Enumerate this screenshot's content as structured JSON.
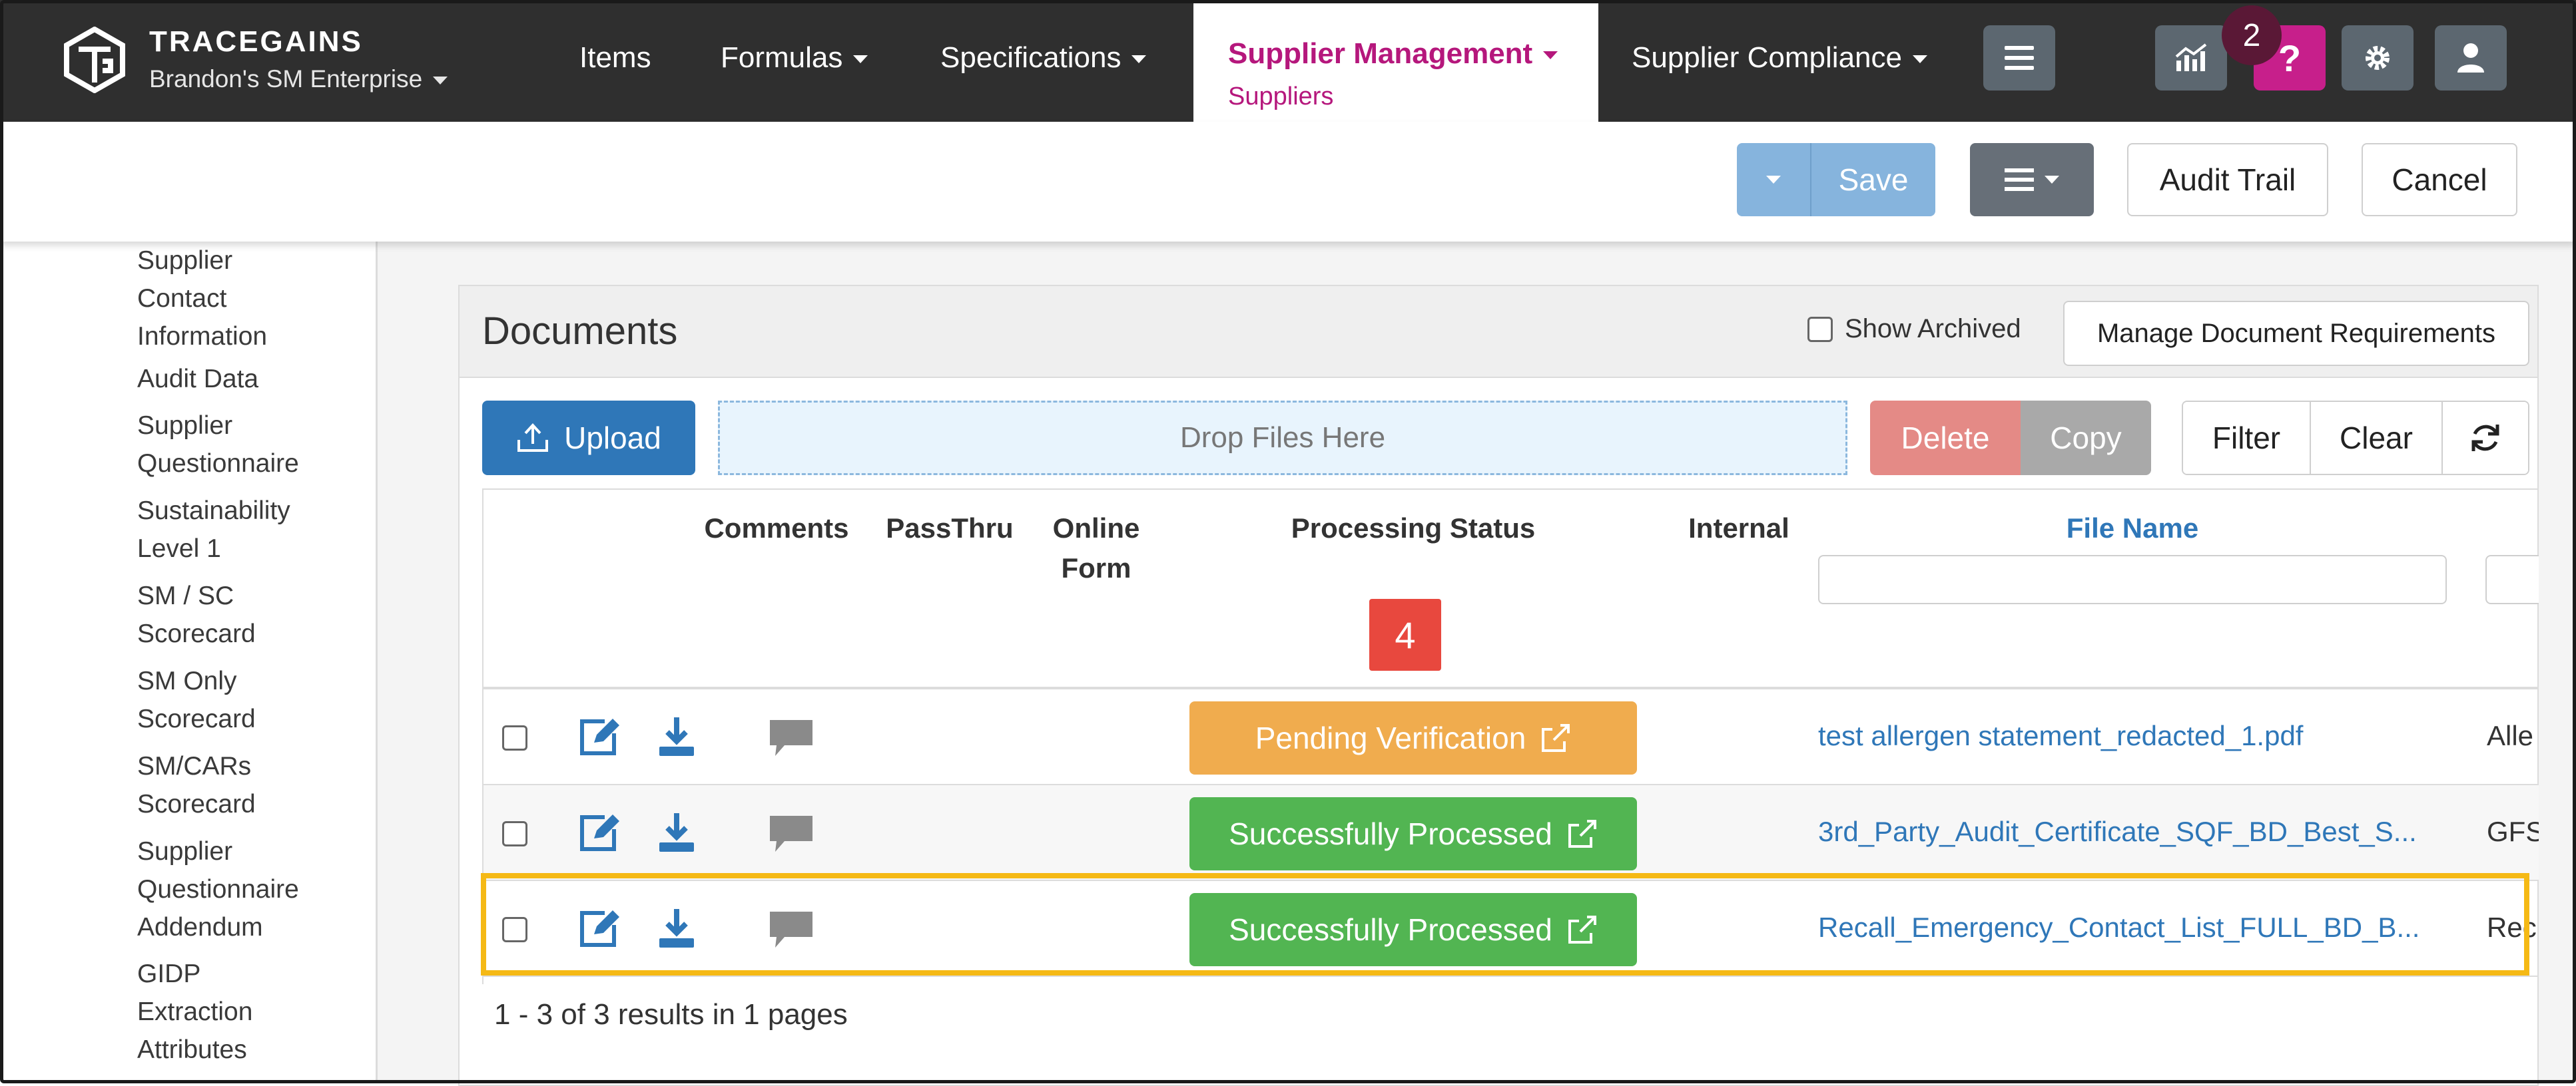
{
  "app": {
    "brand_name": "TRACEGAINS",
    "enterprise": "Brandon's SM Enterprise",
    "nav": {
      "items": "Items",
      "formulas": "Formulas",
      "specifications": "Specifications",
      "supplier_management": "Supplier Management",
      "supplier_management_sub": "Suppliers",
      "supplier_compliance": "Supplier Compliance"
    },
    "notification_count": "2",
    "icons": [
      "menu-icon",
      "analytics-icon",
      "help-icon",
      "gear-icon",
      "user-icon"
    ],
    "accent_color": "#b5177c"
  },
  "toolbar": {
    "save_label": "Save",
    "audit_trail_label": "Audit Trail",
    "cancel_label": "Cancel"
  },
  "sidebar": {
    "items": [
      "Supplier\nContact\nInformation",
      "Audit Data",
      "Supplier\nQuestionnaire",
      "Sustainability\nLevel 1",
      "SM / SC\nScorecard",
      "SM Only\nScorecard",
      "SM/CARs\nScorecard",
      "Supplier\nQuestionnaire\nAddendum",
      "GIDP\nExtraction\nAttributes"
    ]
  },
  "documents": {
    "title": "Documents",
    "show_archived_label": "Show Archived",
    "show_archived_checked": false,
    "manage_requirements_label": "Manage Document Requirements",
    "upload_label": "Upload",
    "drop_label": "Drop Files Here",
    "delete_label": "Delete",
    "copy_label": "Copy",
    "filter_label": "Filter",
    "clear_label": "Clear",
    "columns": {
      "comments": "Comments",
      "passthru": "PassThru",
      "online_form": "Online\nForm",
      "processing_status": "Processing Status",
      "internal": "Internal",
      "file_name": "File Name"
    },
    "processing_status_count": "4",
    "rows": [
      {
        "status": "Pending Verification",
        "status_color": "#f0ac4e",
        "file_name": "test allergen statement_redacted_1.pdf",
        "next_col": "Alle"
      },
      {
        "status": "Successfully Processed",
        "status_color": "#52b552",
        "file_name": "3rd_Party_Audit_Certificate_SQF_BD_Best_S...",
        "next_col": "GFS"
      },
      {
        "status": "Successfully Processed",
        "status_color": "#52b552",
        "file_name": "Recall_Emergency_Contact_List_FULL_BD_B...",
        "next_col": "Rec"
      }
    ],
    "highlighted_row": 3,
    "results_text": "1 - 3 of 3 results in 1 pages"
  }
}
